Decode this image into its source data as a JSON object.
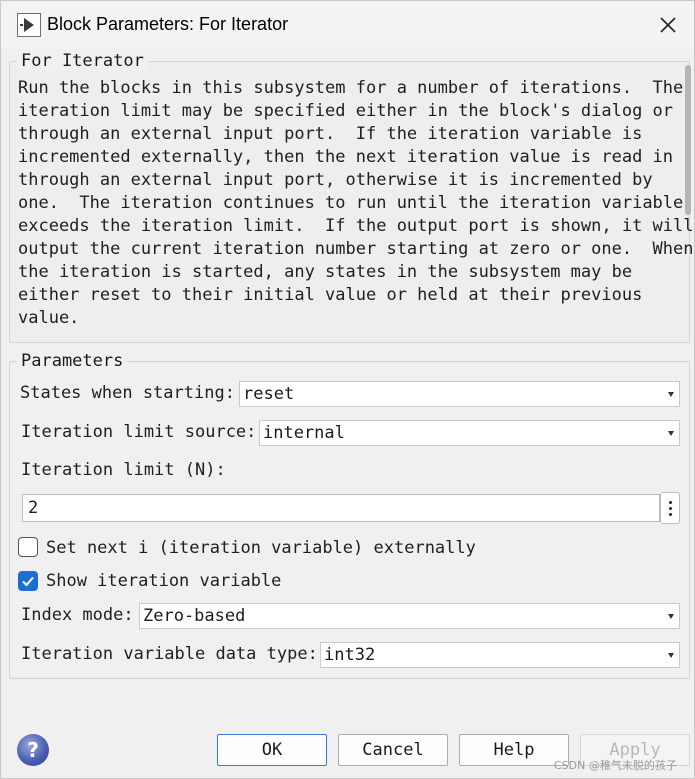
{
  "window": {
    "title": "Block Parameters: For Iterator"
  },
  "description": {
    "legend": "For Iterator",
    "text": "Run the blocks in this subsystem for a number of iterations.  The\niteration limit may be specified either in the block's dialog or\nthrough an external input port.  If the iteration variable is\nincremented externally, then the next iteration value is read in\nthrough an external input port, otherwise it is incremented by\none.  The iteration continues to run until the iteration variable\nexceeds the iteration limit.  If the output port is shown, it will\noutput the current iteration number starting at zero or one.  When\nthe iteration is started, any states in the subsystem may be\neither reset to their initial value or held at their previous\nvalue."
  },
  "parameters": {
    "legend": "Parameters",
    "states_when_starting": {
      "label": "States when starting:",
      "value": "reset"
    },
    "iteration_limit_source": {
      "label": "Iteration limit source:",
      "value": "internal"
    },
    "iteration_limit": {
      "label": "Iteration limit (N):",
      "value": "2"
    },
    "set_next_i": {
      "label": "Set next i (iteration variable) externally",
      "checked": false
    },
    "show_iteration_variable": {
      "label": "Show iteration variable",
      "checked": true
    },
    "index_mode": {
      "label": "Index mode:",
      "value": "Zero-based"
    },
    "iteration_variable_data_type": {
      "label": "Iteration variable data type:",
      "value": "int32"
    }
  },
  "buttons": {
    "ok": "OK",
    "cancel": "Cancel",
    "help": "Help",
    "apply": "Apply"
  },
  "watermark": "CSDN @稚气未脱的孩子",
  "colors": {
    "accent": "#1a6fd1",
    "window_bg": "#f0f0f0",
    "disabled_text": "#b8b8b8"
  }
}
